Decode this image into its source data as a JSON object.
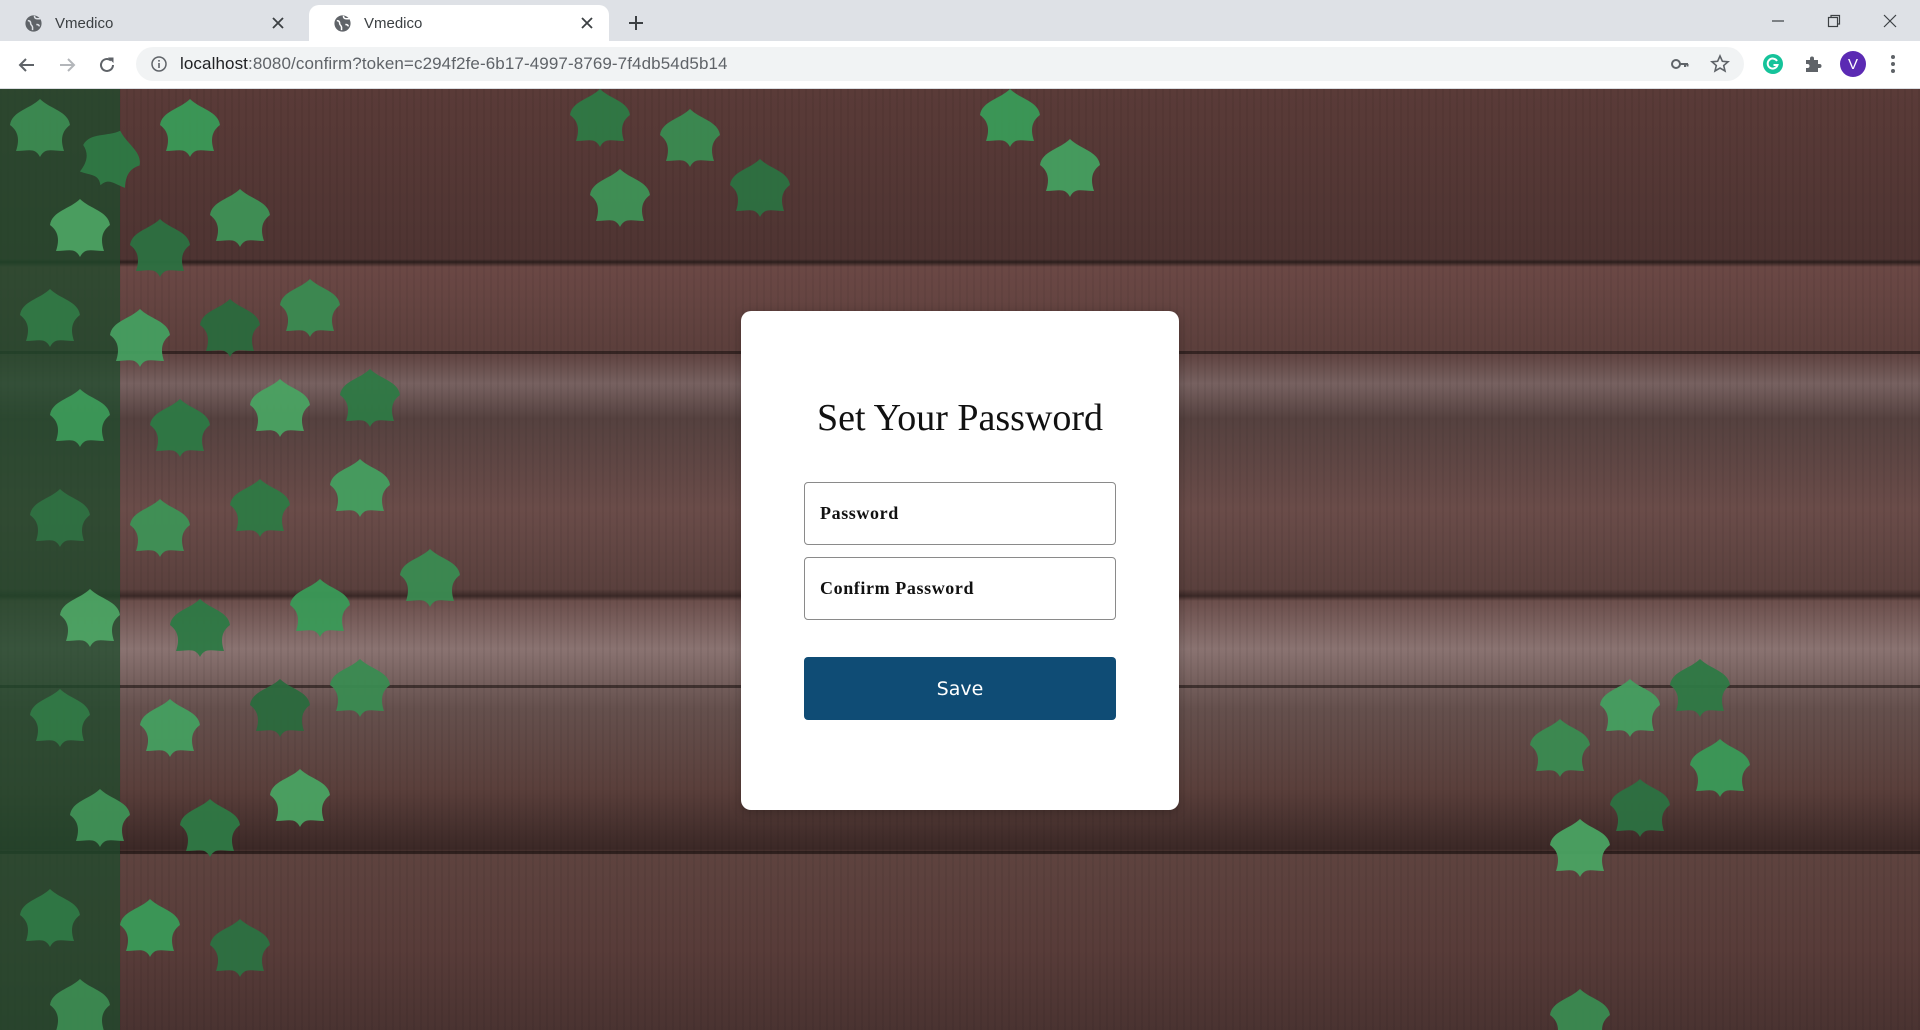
{
  "browser": {
    "tabs": [
      {
        "title": "Vmedico",
        "active": false
      },
      {
        "title": "Vmedico",
        "active": true
      }
    ],
    "address": {
      "host": "localhost",
      "path": ":8080/confirm?token=c294f2fe-6b17-4997-8769-7f4db54d5b14"
    },
    "profile_initial": "V",
    "colors": {
      "tabstrip": "#dee1e6",
      "avatar": "#5b2ab3",
      "grammarly": "#15c39a"
    }
  },
  "page": {
    "title": "Set Your Password",
    "password_placeholder": "Password",
    "confirm_placeholder": "Confirm Password",
    "save_label": "Save",
    "colors": {
      "save_button": "#0f4c75",
      "card": "#ffffff"
    }
  },
  "icons": [
    "globe-icon",
    "close-icon",
    "plus-icon",
    "minimize-icon",
    "restore-icon",
    "window-close-icon",
    "back-arrow-icon",
    "forward-arrow-icon",
    "reload-icon",
    "info-icon",
    "key-icon",
    "star-icon",
    "grammarly-icon",
    "puzzle-icon",
    "more-vert-icon"
  ]
}
